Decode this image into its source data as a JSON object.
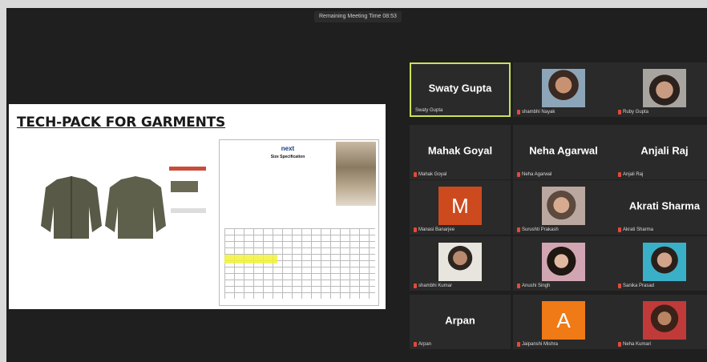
{
  "meeting": {
    "timer": "Remaining Meeting Time 08:53"
  },
  "share": {
    "title": "TECH-PACK FOR GARMENTS",
    "logo": "next",
    "sheet_title": "Size Specification"
  },
  "tiles": [
    {
      "name": "Swaty Gupta",
      "label": "Swaty Gupta",
      "display": "name",
      "active": true
    },
    {
      "name": "",
      "label": "shambhi Nayak",
      "display": "photo",
      "photo": "photo-1"
    },
    {
      "name": "",
      "label": "Ruby Gupta",
      "display": "photo",
      "photo": "photo-2"
    },
    {
      "name": "Mahak Goyal",
      "label": "Mahak Goyal",
      "display": "name"
    },
    {
      "name": "Neha Agarwal",
      "label": "Neha Agarwal",
      "display": "name"
    },
    {
      "name": "Anjali Raj",
      "label": "Anjali Raj",
      "display": "name"
    },
    {
      "name": "",
      "label": "Manasi Banarjee",
      "display": "letter",
      "letter": "M",
      "color": "#cc4a1e"
    },
    {
      "name": "",
      "label": "Surushti Prakash",
      "display": "photo",
      "photo": "photo-3"
    },
    {
      "name": "Akrati Sharma",
      "label": "Akrati Sharma",
      "display": "name"
    },
    {
      "name": "",
      "label": "shambhi Kumar",
      "display": "photo",
      "photo": "photo-4"
    },
    {
      "name": "",
      "label": "Anushi Singh",
      "display": "photo",
      "photo": "photo-5"
    },
    {
      "name": "",
      "label": "Sanika Prasad",
      "display": "photo",
      "photo": "photo-6"
    },
    {
      "name": "Arpan",
      "label": "Arpan",
      "display": "name"
    },
    {
      "name": "",
      "label": "Jaipanshi Mishra",
      "display": "letter",
      "letter": "A",
      "color": "#f07a16"
    },
    {
      "name": "",
      "label": "Neha Kumari",
      "display": "photo",
      "photo": "photo-7"
    }
  ]
}
